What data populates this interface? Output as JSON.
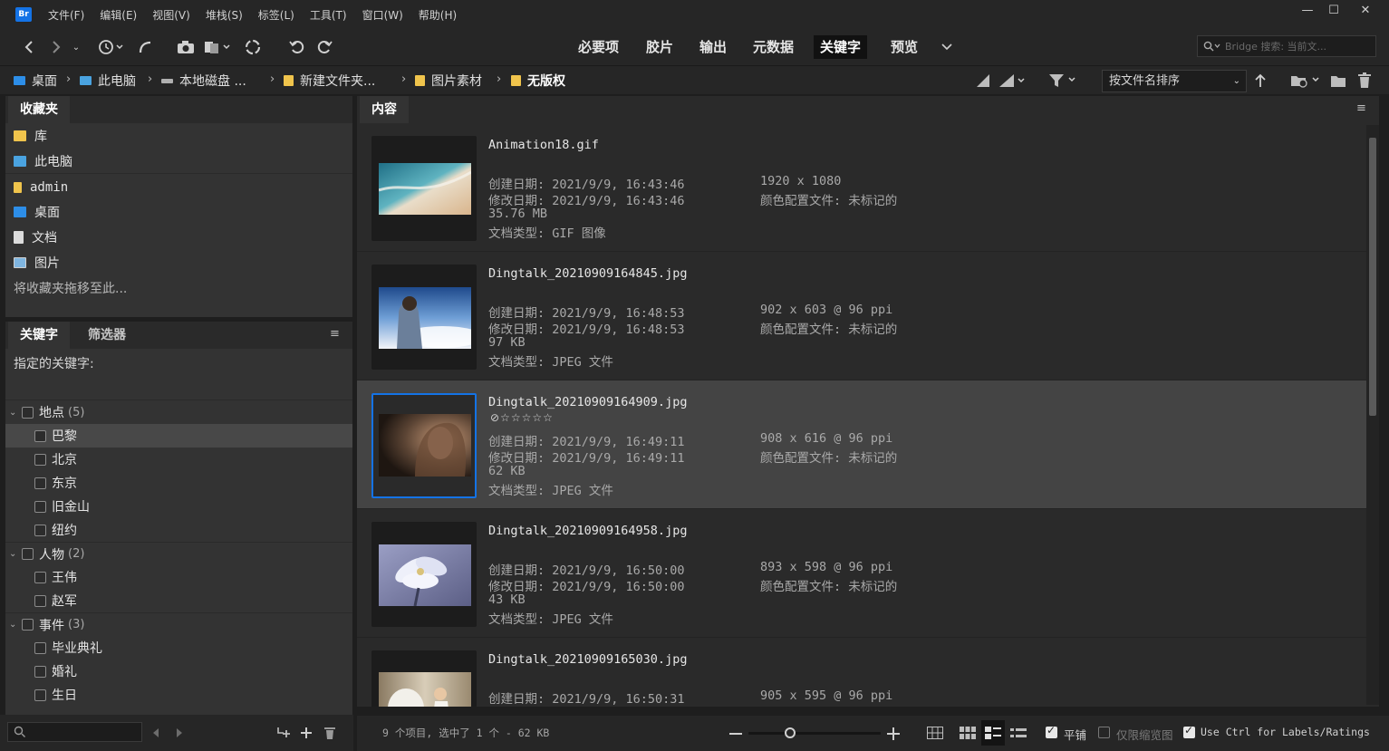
{
  "app": {
    "logo_text": "Br"
  },
  "menubar": {
    "items": [
      "文件(F)",
      "编辑(E)",
      "视图(V)",
      "堆栈(S)",
      "标签(L)",
      "工具(T)",
      "窗口(W)",
      "帮助(H)"
    ]
  },
  "window_controls": {
    "minimize": "—",
    "maximize": "☐",
    "close": "✕"
  },
  "workspace_tabs": [
    {
      "label": "必要项",
      "active": false
    },
    {
      "label": "胶片",
      "active": false
    },
    {
      "label": "输出",
      "active": false
    },
    {
      "label": "元数据",
      "active": false
    },
    {
      "label": "关键字",
      "active": true
    },
    {
      "label": "预览",
      "active": false
    }
  ],
  "search": {
    "placeholder": "Bridge 搜索: 当前文..."
  },
  "path": [
    {
      "label": "桌面",
      "icon": "desktop-icon"
    },
    {
      "label": "此电脑",
      "icon": "computer-icon"
    },
    {
      "label": "本地磁盘 ...",
      "icon": "drive-icon"
    },
    {
      "label": "新建文件夹...",
      "icon": "folder-icon"
    },
    {
      "label": "图片素材",
      "icon": "folder-icon"
    },
    {
      "label": "无版权",
      "icon": "folder-icon"
    }
  ],
  "sort": {
    "label": "按文件名排序"
  },
  "favorites": {
    "tab": "收藏夹",
    "items": [
      {
        "label": "库",
        "icon": "library-icon"
      },
      {
        "label": "此电脑",
        "icon": "computer-icon"
      },
      {
        "label": "admin",
        "icon": "folder-icon"
      },
      {
        "label": "桌面",
        "icon": "desktop-icon"
      },
      {
        "label": "文档",
        "icon": "document-icon"
      },
      {
        "label": "图片",
        "icon": "pictures-icon"
      }
    ],
    "hint": "将收藏夹拖移至此..."
  },
  "keywords": {
    "tabs": [
      "关键字",
      "筛选器"
    ],
    "assigned_label": "指定的关键字:",
    "groups": [
      {
        "name": "地点",
        "count": "(5)",
        "items": [
          "巴黎",
          "北京",
          "东京",
          "旧金山",
          "纽约"
        ]
      },
      {
        "name": "人物",
        "count": "(2)",
        "items": [
          "王伟",
          "赵军"
        ]
      },
      {
        "name": "事件",
        "count": "(3)",
        "items": [
          "毕业典礼",
          "婚礼",
          "生日"
        ]
      }
    ],
    "selected_item": "巴黎"
  },
  "content": {
    "tab": "内容",
    "items": [
      {
        "name": "Animation18.gif",
        "rating": "",
        "created": "创建日期: 2021/9/9, 16:43:46",
        "modified": "修改日期: 2021/9/9, 16:43:46",
        "size": "35.76 MB",
        "type": "文档类型: GIF 图像",
        "dims": "1920 x 1080",
        "profile": "颜色配置文件: 未标记的",
        "selected": false
      },
      {
        "name": "Dingtalk_20210909164845.jpg",
        "rating": "",
        "created": "创建日期: 2021/9/9, 16:48:53",
        "modified": "修改日期: 2021/9/9, 16:48:53",
        "size": "97 KB",
        "type": "文档类型: JPEG 文件",
        "dims": "902 x 603 @ 96 ppi",
        "profile": "颜色配置文件: 未标记的",
        "selected": false
      },
      {
        "name": "Dingtalk_20210909164909.jpg",
        "rating": "⊘☆☆☆☆☆",
        "created": "创建日期: 2021/9/9, 16:49:11",
        "modified": "修改日期: 2021/9/9, 16:49:11",
        "size": "62 KB",
        "type": "文档类型: JPEG 文件",
        "dims": "908 x 616 @ 96 ppi",
        "profile": "颜色配置文件: 未标记的",
        "selected": true
      },
      {
        "name": "Dingtalk_20210909164958.jpg",
        "rating": "",
        "created": "创建日期: 2021/9/9, 16:50:00",
        "modified": "修改日期: 2021/9/9, 16:50:00",
        "size": "43 KB",
        "type": "文档类型: JPEG 文件",
        "dims": "893 x 598 @ 96 ppi",
        "profile": "颜色配置文件: 未标记的",
        "selected": false
      },
      {
        "name": "Dingtalk_20210909165030.jpg",
        "rating": "",
        "created": "创建日期: 2021/9/9, 16:50:31",
        "modified": "",
        "size": "",
        "type": "",
        "dims": "905 x 595 @ 96 ppi",
        "profile": "",
        "selected": false
      }
    ]
  },
  "status": {
    "text": "9 个项目, 选中了 1 个 - 62 KB"
  },
  "bottom": {
    "tile_label": "平铺",
    "tile_checked": true,
    "thumbs_only_label": "仅限缩览图",
    "thumbs_only_checked": false,
    "ctrl_label": "Use Ctrl for Labels/Ratings",
    "ctrl_checked": true
  }
}
